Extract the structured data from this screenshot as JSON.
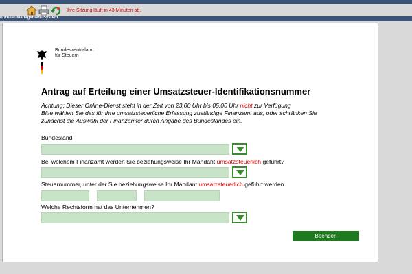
{
  "toolbar": {
    "icons": [
      "home-icon",
      "print-icon",
      "refresh-icon"
    ],
    "session_text": "Ihre Sitzung läuft in 43 Minuten ab."
  },
  "app": {
    "title": "ormular-Management-System"
  },
  "logo": {
    "line1": "Bundeszentralamt",
    "line2": "für Steuern"
  },
  "form": {
    "title": "Antrag auf Erteilung einer Umsatzsteuer-Identifikationsnummer",
    "notice": {
      "line1_a": "Achtung: Dieser Online-Dienst steht in der Zeit von 23.00 Uhr bis 05.00 Uhr",
      "line1_red": "nicht",
      "line1_b": "zur Verfügung",
      "line2": "Bitte wählen Sie das für Ihre umsatzsteuerliche Erfassung zuständige Finanzamt aus, oder schränken Sie",
      "line3": "zunächst die Auswahl der Finanzämter durch Angabe des Bundeslandes ein."
    },
    "bundesland_label": "Bundesland",
    "finanzamt_label_a": "Bei welchem Finanzamt werden Sie beziehungsweise Ihr Mandant",
    "finanzamt_label_red": "umsatzsteuerlich",
    "finanzamt_label_b": "geführt?",
    "steuernummer_label_a": "Steuernummer, unter der Sie beziehungsweise Ihr Mandant",
    "steuernummer_label_red": "umsatzsteuerlich",
    "steuernummer_label_b": "geführt werden",
    "rechtsform_label": "Welche Rechtsform hat das Unternehmen?",
    "end_button": "Beenden"
  },
  "colors": {
    "header": "#3c5477",
    "field": "#c9e3c9",
    "accent_green": "#3a8a2e",
    "button": "#1f7a1f",
    "warning_red": "#e00000"
  }
}
